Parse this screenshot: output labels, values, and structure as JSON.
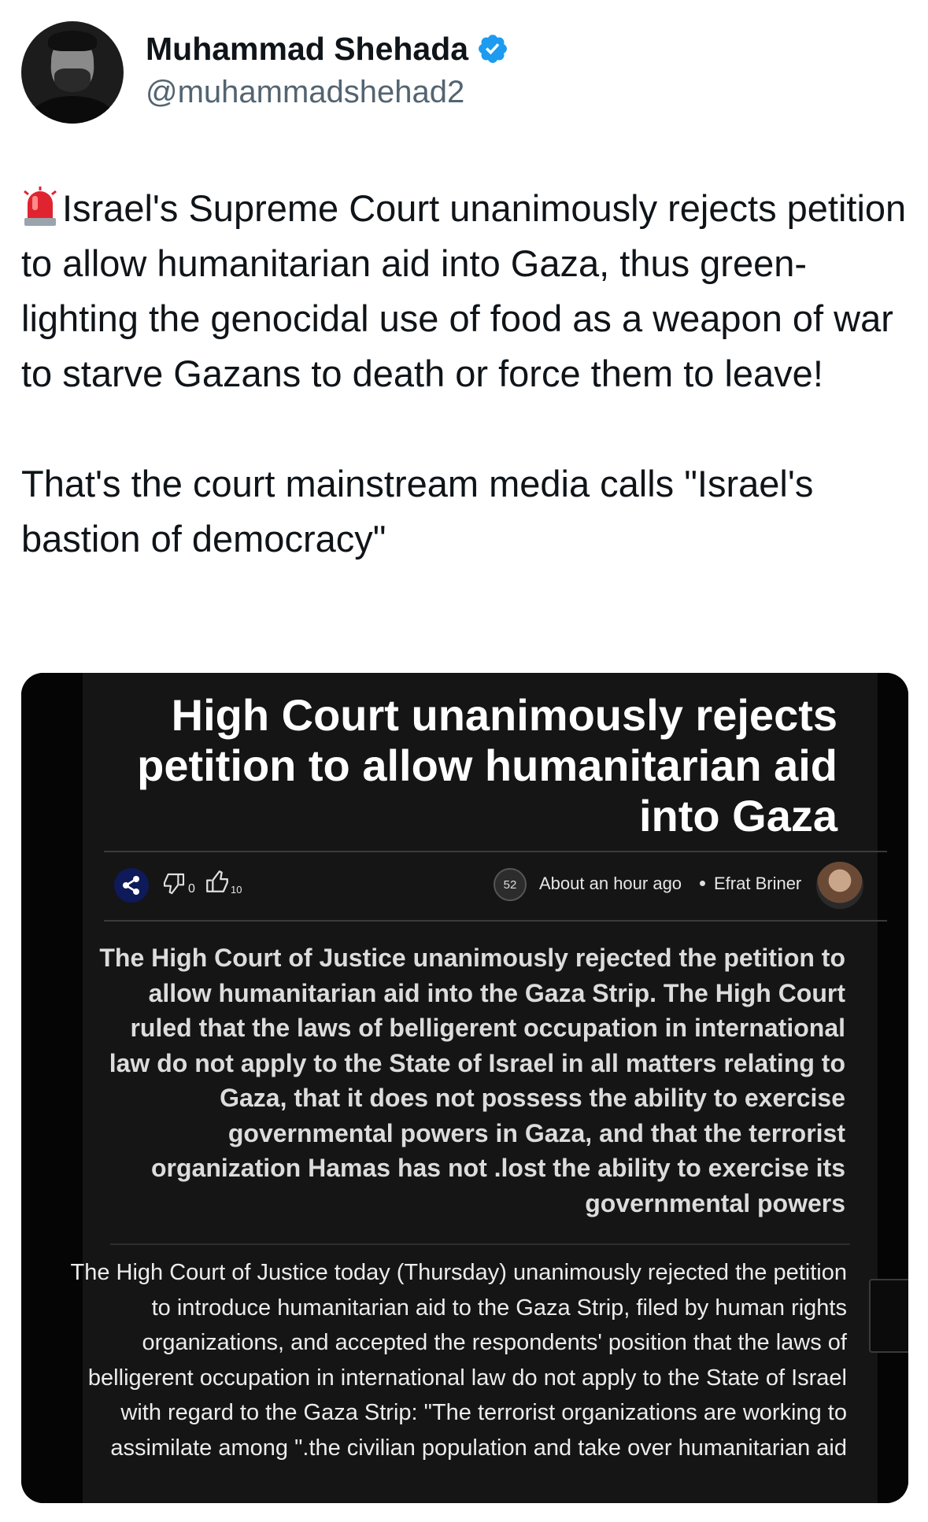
{
  "author": {
    "name": "Muhammad Shehada",
    "handle": "@muhammadshehad2",
    "verified": true
  },
  "tweet": {
    "emoji": "police-car-light",
    "paragraph1": "Israel's Supreme Court unanimously rejects petition to allow humanitarian aid into Gaza, thus green-lighting the genocidal use of food as a weapon of war to starve Gazans to death or force them to leave!",
    "paragraph2": "That's the court mainstream media calls \"Israel's bastion of democracy\""
  },
  "article": {
    "headline": "High Court unanimously rejects petition to allow humanitarian aid into Gaza",
    "dislikes": "0",
    "likes": "10",
    "comments": "52",
    "time": "About an hour ago",
    "author": "Efrat Briner",
    "summary": "The High Court of Justice unanimously rejected the petition to allow humanitarian aid into the Gaza Strip. The High Court ruled that the laws of belligerent occupation in international law do not apply to the State of Israel in all matters relating to Gaza, that it does not possess the ability to exercise governmental powers in Gaza, and that the terrorist organization Hamas has not .lost the ability to exercise its governmental powers",
    "body": "The High Court of Justice today (Thursday) unanimously rejected the petition to introduce humanitarian aid to the Gaza Strip, filed by human rights organizations, and accepted the respondents' position that the laws of belligerent occupation in international law do not apply to the State of Israel with regard to the Gaza Strip: \"The terrorist organizations are working to assimilate among \".the civilian population and take over humanitarian aid"
  },
  "colors": {
    "verified": "#1d9bf0",
    "handle": "#536471",
    "media_bg": "#151515",
    "share_circle": "#0e1a5a"
  }
}
